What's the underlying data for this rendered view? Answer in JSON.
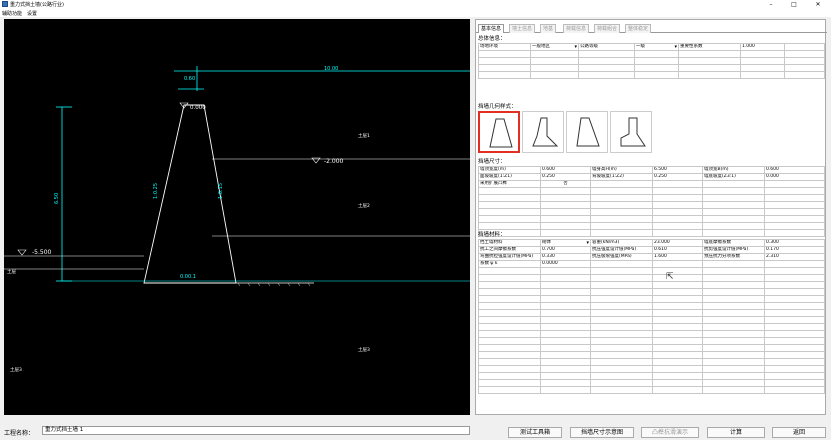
{
  "window": {
    "title": "重力式挡土墙(公路行业)",
    "minimize": "–",
    "maximize": "□",
    "close": "✕"
  },
  "menu": {
    "items": [
      "辅助功能",
      "设置"
    ]
  },
  "drawing": {
    "top_width_label": "0.60",
    "top_ext_label": "10.00",
    "crest_label": "0.000",
    "water_label": "-2.000",
    "left_level_label": "-5.500",
    "height_label": "6.50",
    "slope_left_label": "1:0.25",
    "slope_right_label": "1:0.15",
    "base_label": "0.00.1",
    "soil_labels": [
      "土层1",
      "土层2",
      "土层3"
    ],
    "left_soil_label": "土层",
    "bottom_left_label": "土层3"
  },
  "tabs": [
    "基本信息",
    "墙土信息",
    "地基",
    "荷载信息",
    "荷载组合",
    "整体稳定"
  ],
  "overall": {
    "title": "总体信息：",
    "row": {
      "site_label": "场地环境",
      "site_value": "一般地区",
      "road_label": "公路等级",
      "road_value": "一级",
      "factor_label": "重要性系数",
      "factor_value": "1.000"
    }
  },
  "shapes": {
    "title": "挡墙几何样式：",
    "items": [
      "style-1",
      "style-2",
      "style-3",
      "style-4"
    ]
  },
  "dimensions": {
    "title": "挡墙尺寸：",
    "rows": [
      [
        "墙顶宽度(m)",
        "0.600",
        "墙身高H(m)",
        "6.500",
        "墙顶宽B(m)",
        "0.600"
      ],
      [
        "面坡坡度(1:Z1)",
        "0.250",
        "背坡坡度(1:Z2)",
        "0.250",
        "墙底坡度(Z3:1)",
        "0.000"
      ],
      [
        "采用扩展凸榫",
        "否",
        "",
        "",
        "",
        ""
      ]
    ]
  },
  "materials": {
    "title": "挡墙材料：",
    "rows": [
      [
        "挡土墙材料",
        "砌体",
        "容重(kN/m3)",
        "23.000",
        "墙底摩擦系数",
        "0.300"
      ],
      [
        "抗工之间摩擦系数",
        "0.700",
        "抗压强度设计值(MPa)",
        "0.610",
        "抗剪强度设计值(MPa)",
        "0.170"
      ],
      [
        "弯曲抗拉强度设计值(MPa)",
        "0.330",
        "抗压极限强度(MPa)",
        "1.600",
        "预压抗力分项系数",
        "2.310"
      ],
      [
        "系数 ψ k",
        "0.0000",
        "",
        "",
        "",
        ""
      ]
    ]
  },
  "footer": {
    "project_label": "工程名称：",
    "project_name": "重力式挡土墙 1",
    "buttons": [
      "测试工具箱",
      "挡墙尺寸示意图",
      "凸榫抗滑演示",
      "计算",
      "返回"
    ]
  }
}
